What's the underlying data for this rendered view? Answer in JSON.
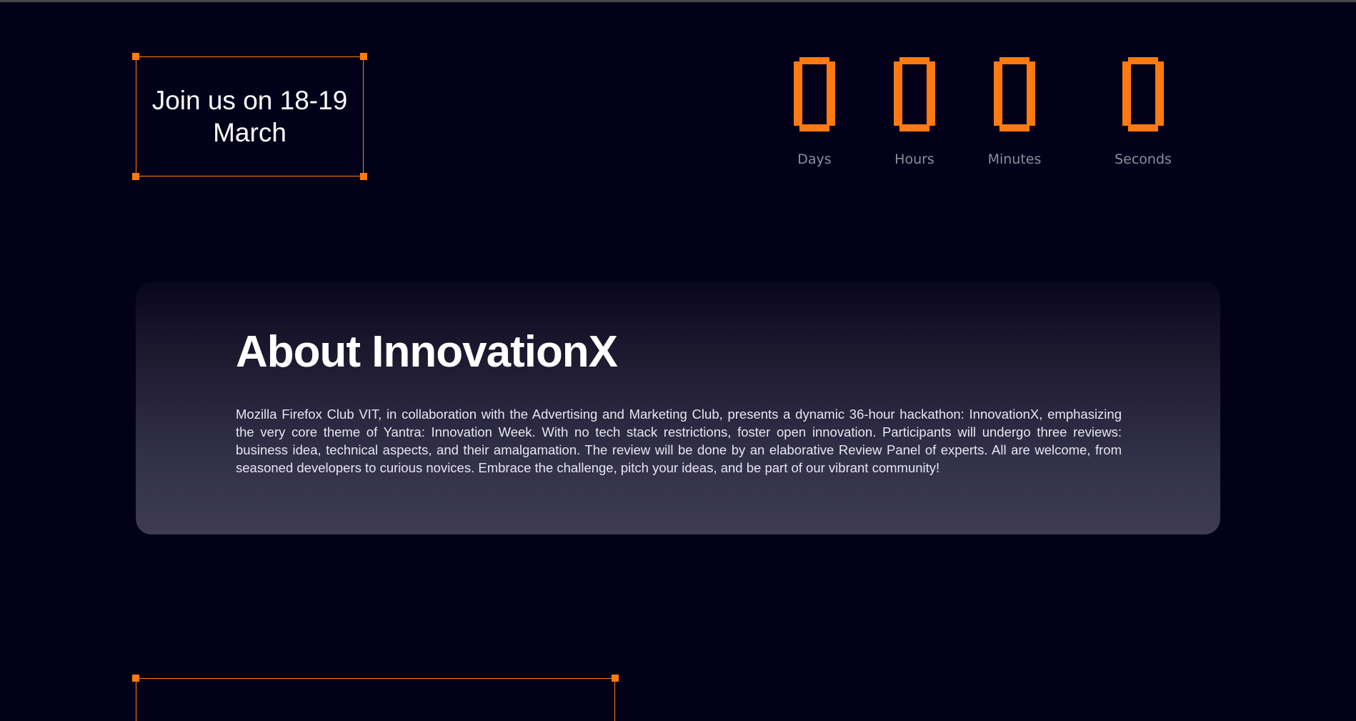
{
  "event_date": {
    "text": "Join us on 18-19 March"
  },
  "countdown": {
    "units": [
      {
        "value": "0",
        "label": "Days"
      },
      {
        "value": "0",
        "label": "Hours"
      },
      {
        "value": "0",
        "label": "Minutes"
      },
      {
        "value": "0",
        "label": "Seconds"
      }
    ]
  },
  "about": {
    "title": "About InnovationX",
    "body": "Mozilla Firefox Club VIT, in collaboration with the Advertising and Marketing Club, presents a dynamic 36-hour hackathon: InnovationX, emphasizing the very core theme of Yantra: Innovation Week. With no tech stack restrictions, foster open innovation. Participants will undergo three reviews: business idea, technical aspects, and their amalgamation. The review will be done by an elaborative Review Panel of experts. All are welcome, from seasoned developers to curious novices. Embrace the challenge, pitch your ideas, and be part of our vibrant community!"
  },
  "colors": {
    "background": "#03011a",
    "accent": "#ff7a10",
    "label": "#8d8d9c"
  }
}
